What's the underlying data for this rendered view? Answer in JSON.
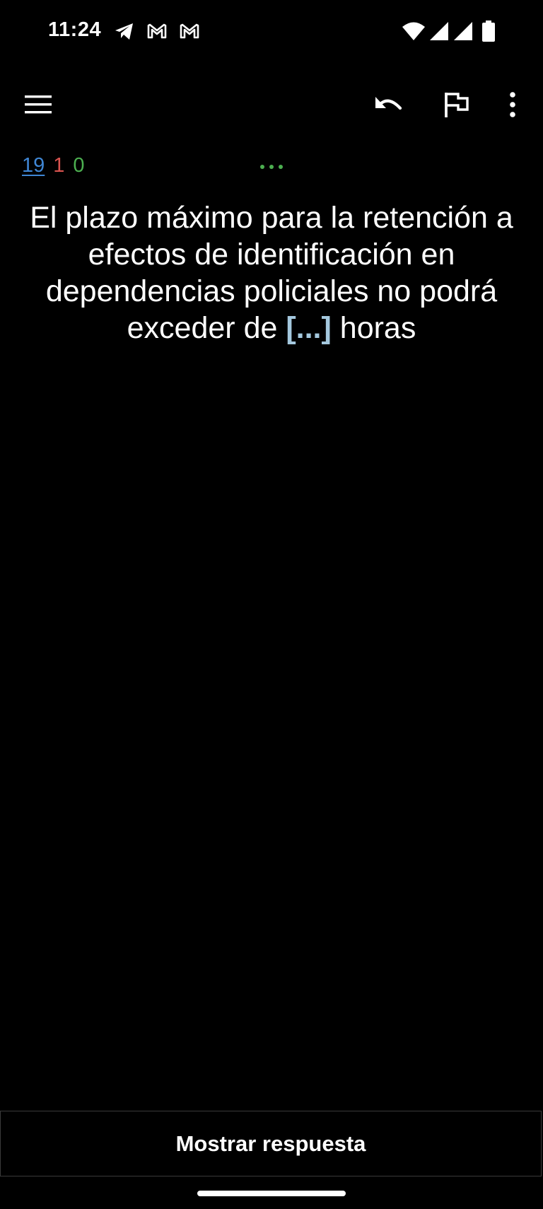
{
  "status_bar": {
    "time": "11:24",
    "notification_icons": [
      "telegram-icon",
      "gmail-icon",
      "gmail-icon"
    ],
    "system_icons": [
      "wifi-icon",
      "signal-icon",
      "signal-icon",
      "battery-icon"
    ]
  },
  "toolbar": {
    "icons": [
      "menu-icon",
      "undo-icon",
      "flag-icon",
      "more-vert-icon"
    ]
  },
  "counts": {
    "new": "19",
    "learning": "1",
    "review": "0"
  },
  "question": {
    "before": "El plazo máximo para la retención a efectos de identificación en dependencias policiales no podrá exceder de ",
    "cloze": "[...]",
    "after": " horas"
  },
  "answer_button": {
    "label": "Mostrar respuesta"
  },
  "colors": {
    "background": "#000000",
    "text": "#ffffff",
    "new_count": "#3f86d4",
    "learning_count": "#d9534f",
    "review_count": "#4caf50",
    "cloze": "#a4c8de",
    "dots": "#4caf50"
  }
}
